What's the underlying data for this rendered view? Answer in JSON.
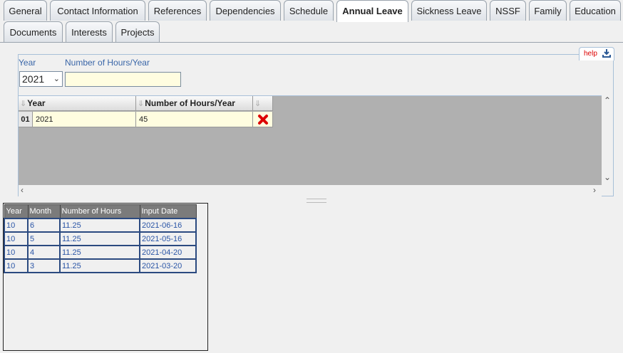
{
  "tabs_row1": [
    "General",
    "Contact Information",
    "References",
    "Dependencies",
    "Schedule",
    "Annual Leave",
    "Sickness Leave",
    "NSSF",
    "Family",
    "Education"
  ],
  "tabs_row2": [
    "Documents",
    "Interests",
    "Projects"
  ],
  "active_tab": "Annual Leave",
  "help": {
    "label": "help",
    "download_icon": "download-icon"
  },
  "form": {
    "year_label": "Year",
    "hours_label": "Number of Hours/Year",
    "year_value": "2021",
    "hours_value": ""
  },
  "grid": {
    "columns": [
      "Year",
      "Number of Hours/Year",
      ""
    ],
    "rows": [
      {
        "num": "01",
        "year": "2021",
        "hours": "45",
        "delete_icon": "delete-x-icon"
      }
    ]
  },
  "history": {
    "columns": [
      "Year",
      "Month",
      "Number of Hours",
      "Input Date"
    ],
    "rows": [
      [
        "10",
        "6",
        "11.25",
        "2021-06-16"
      ],
      [
        "10",
        "5",
        "11.25",
        "2021-05-16"
      ],
      [
        "10",
        "4",
        "11.25",
        "2021-04-20"
      ],
      [
        "10",
        "3",
        "11.25",
        "2021-03-20"
      ]
    ]
  },
  "colors": {
    "accent_label": "#3a66a8",
    "input_bg": "#fffde0",
    "grid_bg": "#b0b0b0",
    "delete": "#dd0000"
  }
}
